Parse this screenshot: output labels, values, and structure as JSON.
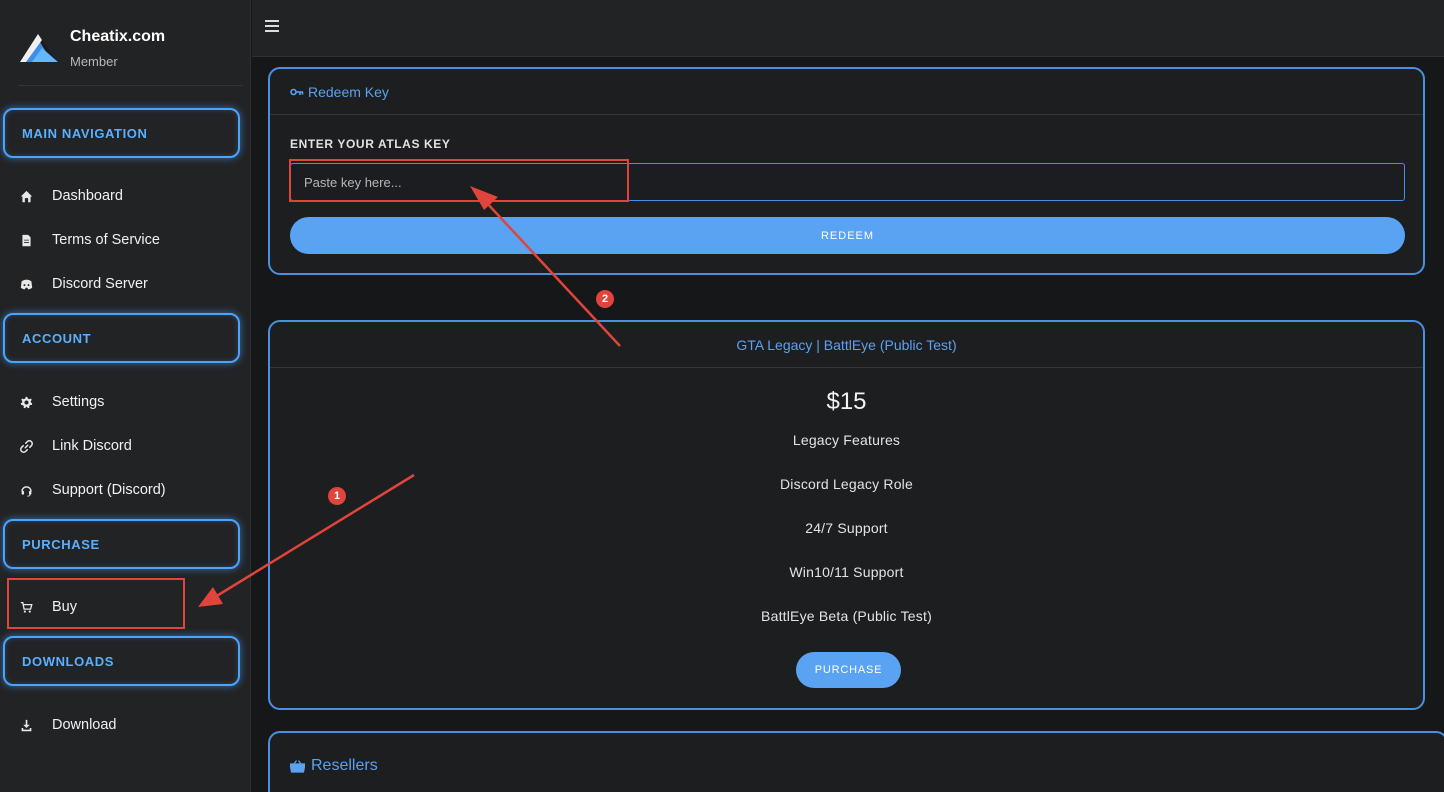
{
  "brand": {
    "name": "Cheatix.com",
    "role": "Member"
  },
  "sections": {
    "main_navigation": "MAIN NAVIGATION",
    "account": "ACCOUNT",
    "purchase": "PURCHASE",
    "downloads": "DOWNLOADS"
  },
  "nav": {
    "dashboard": "Dashboard",
    "tos": "Terms of Service",
    "discord_server": "Discord Server",
    "settings": "Settings",
    "link_discord": "Link Discord",
    "support": "Support (Discord)",
    "buy": "Buy",
    "download": "Download"
  },
  "redeem": {
    "title": "Redeem Key",
    "label": "ENTER YOUR ATLAS KEY",
    "placeholder": "Paste key here...",
    "button": "REDEEM"
  },
  "plan": {
    "title": "GTA Legacy | BattlEye (Public Test)",
    "price": "$15",
    "features": [
      "Legacy Features",
      "Discord Legacy Role",
      "24/7 Support",
      "Win10/11 Support",
      "BattlEye Beta (Public Test)"
    ],
    "button": "PURCHASE"
  },
  "resellers": {
    "title": "Resellers"
  },
  "annotations": {
    "badge1": "1",
    "badge2": "2"
  },
  "colors": {
    "accent": "#4aa3ff",
    "button": "#5aa2f2",
    "annotation": "#e0443a",
    "background": "#161719"
  },
  "icons": [
    "logo-icon",
    "menu-icon",
    "home-icon",
    "document-icon",
    "discord-icon",
    "gear-icon",
    "link-icon",
    "headset-icon",
    "cart-icon",
    "download-icon",
    "key-icon",
    "basket-icon"
  ]
}
